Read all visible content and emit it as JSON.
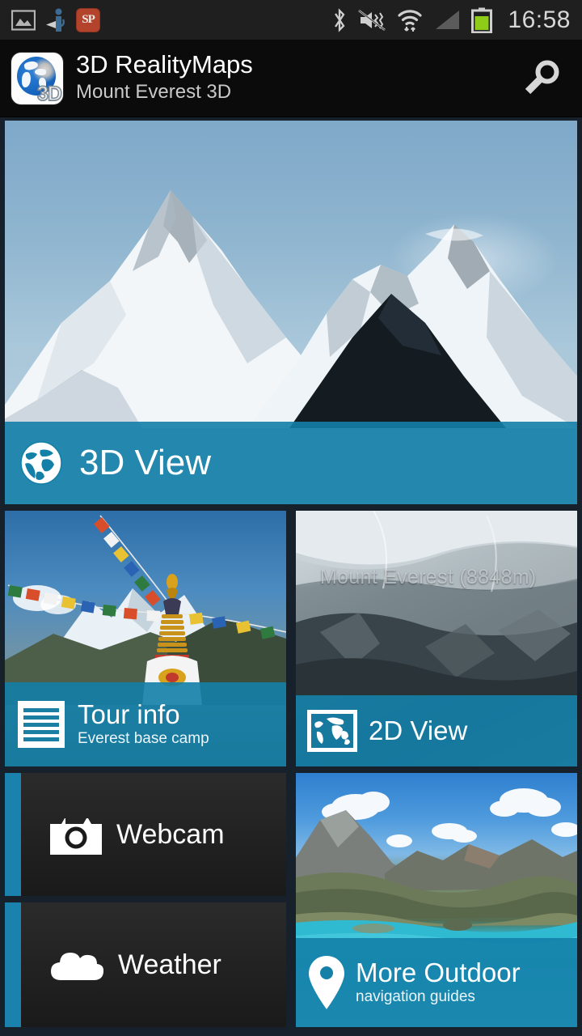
{
  "statusbar": {
    "time": "16:58",
    "left_icons": [
      {
        "name": "screenshot-icon",
        "label": "Screenshot"
      },
      {
        "name": "share-icon",
        "label": "Share / S Beam"
      },
      {
        "name": "sp-app-icon",
        "label": "SP"
      }
    ],
    "right_icons": [
      {
        "name": "bluetooth-icon",
        "label": "Bluetooth"
      },
      {
        "name": "mute-vibrate-icon",
        "label": "Sound off / vibrate"
      },
      {
        "name": "wifi-icon",
        "label": "Wi-Fi"
      },
      {
        "name": "signal-icon",
        "label": "Mobile signal"
      },
      {
        "name": "battery-icon",
        "label": "Battery"
      }
    ],
    "sp_badge_text": "SP"
  },
  "appbar": {
    "logo_name": "3d-realitymaps-logo",
    "logo_badge": "3D",
    "title": "3D RealityMaps",
    "subtitle": "Mount Everest 3D",
    "search_icon": "search-icon"
  },
  "tiles": [
    {
      "id": "hero",
      "name": "tile-3d-view",
      "title": "3D View",
      "subtitle": "",
      "icon": "globe-icon",
      "photo": "mount-everest-lhotse-panorama",
      "overlay_color": "#1480a8"
    },
    {
      "id": "tour",
      "name": "tile-tour-info",
      "title": "Tour info",
      "subtitle": "Everest base camp",
      "icon": "document-lines-icon",
      "photo": "prayer-flags-stupa",
      "overlay_color": "#1480a8"
    },
    {
      "id": "twod",
      "name": "tile-2d-view",
      "title": "2D View",
      "subtitle": "",
      "icon": "world-map-icon",
      "photo": "satellite-everest",
      "photo_label": "Mount Everest (8848m)",
      "overlay_color": "#1480a8"
    },
    {
      "id": "webcam",
      "name": "tile-webcam",
      "title": "Webcam",
      "subtitle": "",
      "icon": "camera-icon",
      "photo": "dark-texture",
      "accent_color": "#1b81ad"
    },
    {
      "id": "weather",
      "name": "tile-weather",
      "title": "Weather",
      "subtitle": "",
      "icon": "cloud-icon",
      "photo": "dark-texture",
      "accent_color": "#1b81ad"
    },
    {
      "id": "more",
      "name": "tile-more-outdoor",
      "title": "More Outdoor",
      "subtitle": "navigation guides",
      "icon": "map-pin-icon",
      "photo": "alpine-lake",
      "overlay_color": "#1480a8"
    }
  ],
  "colors": {
    "accent_blue": "#1480a8",
    "accent_bar": "#1b81ad",
    "statusbar_bg": "#1f1f1f",
    "appbar_bg": "#0b0b0b",
    "battery_green": "#8fcc18",
    "page_bg": "#16212c"
  }
}
